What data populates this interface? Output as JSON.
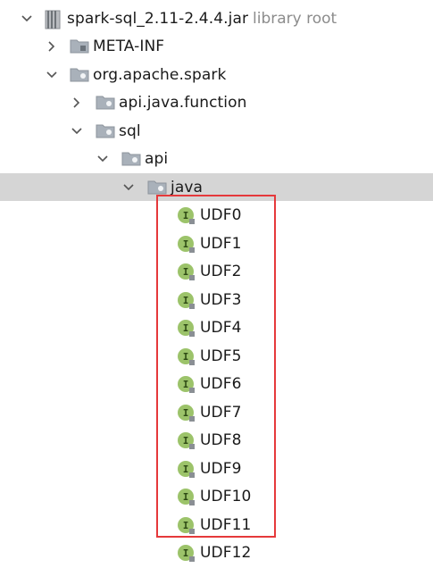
{
  "tree": {
    "root": {
      "label": "spark-sql_2.11-2.4.4.jar",
      "hint": "library root",
      "icon": "jar-icon"
    },
    "meta_inf": {
      "label": "META-INF",
      "icon": "folder-icon"
    },
    "org_apache_spark": {
      "label": "org.apache.spark",
      "icon": "package-icon"
    },
    "api_java_function": {
      "label": "api.java.function",
      "icon": "package-icon"
    },
    "sql": {
      "label": "sql",
      "icon": "package-icon"
    },
    "api": {
      "label": "api",
      "icon": "package-icon"
    },
    "java": {
      "label": "java",
      "icon": "package-icon"
    },
    "interfaces": [
      {
        "label": "UDF0",
        "icon": "interface-icon"
      },
      {
        "label": "UDF1",
        "icon": "interface-icon"
      },
      {
        "label": "UDF2",
        "icon": "interface-icon"
      },
      {
        "label": "UDF3",
        "icon": "interface-icon"
      },
      {
        "label": "UDF4",
        "icon": "interface-icon"
      },
      {
        "label": "UDF5",
        "icon": "interface-icon"
      },
      {
        "label": "UDF6",
        "icon": "interface-icon"
      },
      {
        "label": "UDF7",
        "icon": "interface-icon"
      },
      {
        "label": "UDF8",
        "icon": "interface-icon"
      },
      {
        "label": "UDF9",
        "icon": "interface-icon"
      },
      {
        "label": "UDF10",
        "icon": "interface-icon"
      },
      {
        "label": "UDF11",
        "icon": "interface-icon"
      },
      {
        "label": "UDF12",
        "icon": "interface-icon"
      }
    ]
  },
  "colors": {
    "selection": "#d5d5d5",
    "highlight_border": "#e5393b",
    "interface_green": "#9cc36a",
    "hint_text": "#8c8c8c"
  }
}
